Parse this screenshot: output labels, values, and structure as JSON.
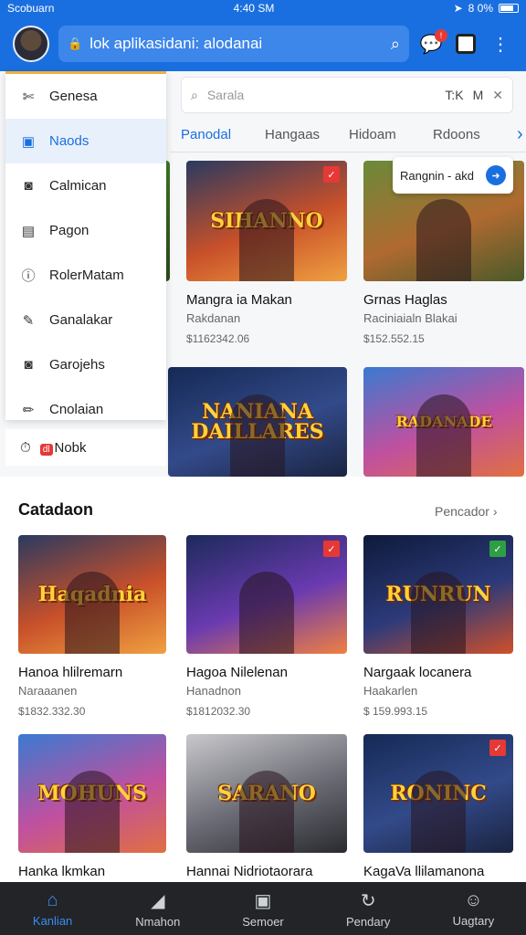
{
  "status_bar": {
    "carrier": "Scobuarn",
    "time": "4:40 SM",
    "battery": "8 0%"
  },
  "app_bar": {
    "url": "lok aplikasidani: alodanai",
    "chat_badge": "!"
  },
  "search": {
    "placeholder": "Sarala",
    "meta1": "T:K",
    "meta2": "M"
  },
  "category_tabs": [
    "Panodal",
    "Hangaas",
    "Hidoam",
    "Rdoons"
  ],
  "drawer": {
    "items": [
      {
        "label": "Genesa",
        "icon": "scissors-icon"
      },
      {
        "label": "Naods",
        "icon": "calendar-icon",
        "active": true
      },
      {
        "label": "Calmican",
        "icon": "camera-icon"
      },
      {
        "label": "Pagon",
        "icon": "page-icon"
      },
      {
        "label": "RolerMatam",
        "icon": "alert-icon"
      },
      {
        "label": "Ganalakar",
        "icon": "edit-icon"
      },
      {
        "label": "Garojehs",
        "icon": "camera-icon"
      },
      {
        "label": "Cnolaian",
        "icon": "pencil-icon"
      }
    ],
    "extra": {
      "badge": "dl",
      "label": "Nobk"
    }
  },
  "tooltip": {
    "text": "Rangnin - akd"
  },
  "top_cards": [
    {
      "art": "SIHANNO",
      "title": "Mangra ia Makan",
      "sub": "Rakdanan",
      "price": "$1162342.06"
    },
    {
      "art": "",
      "title": "Grnas Haglas",
      "sub": "Raciniaialn Blakai",
      "price": "$152.552.15"
    },
    {
      "art": "NANIANA DAILLARES",
      "title": "",
      "sub": "",
      "price": ""
    },
    {
      "art": "RADANADE",
      "title": "",
      "sub": "",
      "price": ""
    }
  ],
  "section": {
    "title": "Catadaon",
    "link": "Pencador"
  },
  "section_cards": [
    {
      "art": "Haqadnia",
      "title": "Hanoa hlilremarn",
      "sub": "Naraaanen",
      "price": "$1832.332.30"
    },
    {
      "art": "",
      "title": "Hagoa Nilelenan",
      "sub": "Hanadnon",
      "price": "$1812032.30"
    },
    {
      "art": "RUNRUN",
      "title": "Nargaak locanera",
      "sub": "Haakarlen",
      "price": "$ 159.993.15"
    },
    {
      "art": "MOHUNS",
      "title": "Hanka lkmkan",
      "sub": "",
      "price": ""
    },
    {
      "art": "SARANO",
      "title": "Hannai Nidriotaorara",
      "sub": "",
      "price": ""
    },
    {
      "art": "RONINC",
      "title": "KagaVa llilamanona",
      "sub": "",
      "price": ""
    }
  ],
  "bottom_nav": [
    {
      "label": "Kanlian",
      "icon": "home-icon",
      "active": true
    },
    {
      "label": "Nmahon",
      "icon": "megaphone-icon"
    },
    {
      "label": "Semoer",
      "icon": "gamepad-icon"
    },
    {
      "label": "Pendary",
      "icon": "refresh-icon"
    },
    {
      "label": "Uagtary",
      "icon": "user-icon"
    }
  ],
  "colors": {
    "brand": "#1a6fe0",
    "active": "#3b8cf5",
    "nav_bg": "#222427"
  }
}
